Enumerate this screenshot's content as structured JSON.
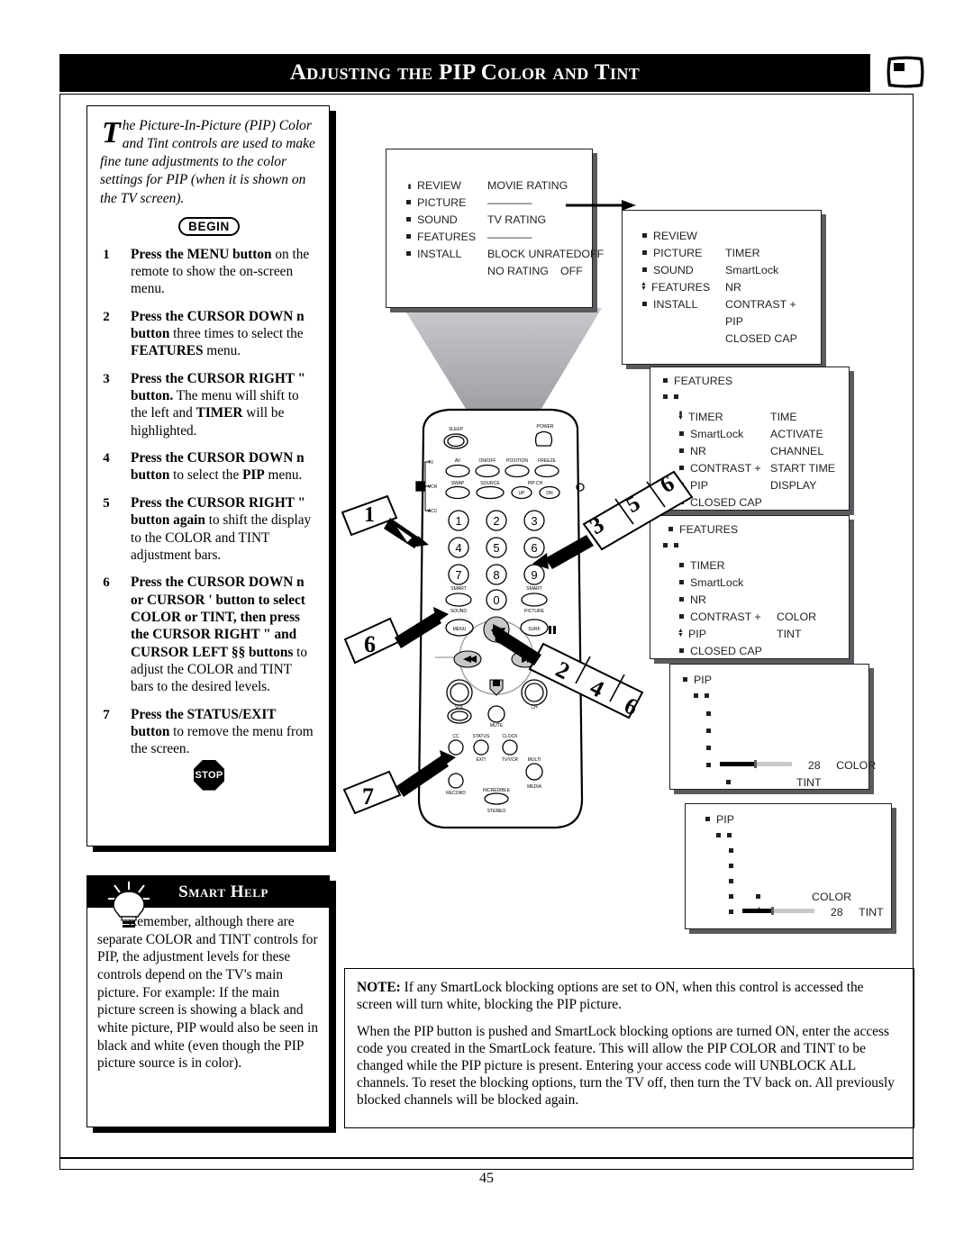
{
  "header": {
    "title": "Adjusting the PIP Color and Tint",
    "icon": "pip-tv-icon"
  },
  "intro": {
    "dropcap": "T",
    "text": "he Picture-In-Picture (PIP) Color and Tint controls are used to make fine tune adjustments to the color settings for PIP (when it is shown on the TV screen)."
  },
  "begin_badge": "BEGIN",
  "stop_badge": "STOP",
  "steps": [
    {
      "num": "1",
      "html": "<b>Press the MENU button</b> on the remote to show the on-screen menu."
    },
    {
      "num": "2",
      "html": "<b>Press the CURSOR DOWN n button</b> three times to select the <b>FEATURES</b> menu."
    },
    {
      "num": "3",
      "html": "<b>Press the CURSOR RIGHT &quot; button.</b> The menu will shift to the left and <b>TIMER</b> will be highlighted."
    },
    {
      "num": "4",
      "html": "<b>Press the CURSOR DOWN n button</b> to select the <b>PIP</b> menu."
    },
    {
      "num": "5",
      "html": "<b>Press the CURSOR RIGHT &quot; button again</b> to shift the display to the COLOR and TINT adjustment bars."
    },
    {
      "num": "6",
      "html": "<b>Press the CURSOR DOWN n or CURSOR ' button to select COLOR or TINT, then press the CURSOR RIGHT &quot; and CURSOR LEFT §§ buttons</b> to adjust the COLOR and TINT bars to the desired levels."
    },
    {
      "num": "7",
      "html": "<b>Press the STATUS/EXIT button</b> to remove the menu from the screen."
    }
  ],
  "smart_help": {
    "title": "Smart Help",
    "icon": "lightbulb-icon",
    "body": "Remember, although there are separate COLOR and TINT controls for PIP, the adjustment levels for these controls depend on the TV's main picture. For example: If the main picture screen is showing a black and white picture, PIP would also be seen in black and white (even though the PIP picture source is in color)."
  },
  "screens": [
    {
      "id": "screen-main-menu",
      "left_items": [
        "REVIEW",
        "PICTURE",
        "SOUND",
        "FEATURES",
        "INSTALL"
      ],
      "right_items": [
        "MOVIE RATING",
        "————",
        "TV RATING",
        "————",
        "BLOCK UNRATED",
        "NO RATING"
      ],
      "right_values": [
        "",
        "",
        "",
        "",
        "OFF",
        "OFF"
      ],
      "cursor_on": "REVIEW"
    },
    {
      "id": "screen-features-highlight",
      "left_items": [
        "REVIEW",
        "PICTURE",
        "SOUND",
        "FEATURES",
        "INSTALL"
      ],
      "right_items": [
        "",
        "TIMER",
        "SmartLock",
        "NR",
        "CONTRAST +",
        "PIP",
        "CLOSED CAP"
      ],
      "cursor_on": "FEATURES"
    },
    {
      "id": "screen-features-timer",
      "title": "FEATURES",
      "left_items": [
        "TIMER",
        "SmartLock",
        "NR",
        "CONTRAST +",
        "PIP",
        "CLOSED CAP"
      ],
      "right_items": [
        "TIME",
        "ACTIVATE",
        "CHANNEL",
        "START TIME",
        "DISPLAY"
      ],
      "cursor_on": "TIMER"
    },
    {
      "id": "screen-features-pip",
      "title": "FEATURES",
      "left_items": [
        "TIMER",
        "SmartLock",
        "NR",
        "CONTRAST +",
        "PIP",
        "CLOSED CAP"
      ],
      "right_items": [
        "COLOR",
        "TINT"
      ],
      "cursor_on": "PIP"
    },
    {
      "id": "screen-pip-color",
      "title": "PIP",
      "selected_label": "COLOR",
      "other_label": "TINT",
      "value": "28"
    },
    {
      "id": "screen-pip-tint",
      "title": "PIP",
      "selected_label": "TINT",
      "other_label": "COLOR",
      "value": "28"
    }
  ],
  "remote": {
    "top_labels": [
      "SLEEP",
      "POWER"
    ],
    "mode_labels": [
      "TV",
      "VCR",
      "ACC"
    ],
    "row1": [
      "AV",
      "ON/OFF",
      "POSITION",
      "FREEZE"
    ],
    "row2": [
      "SWAP",
      "SOURCE",
      "PIP CH",
      "UP",
      "DN"
    ],
    "keypad": [
      "1",
      "2",
      "3",
      "4",
      "5",
      "6",
      "7",
      "8",
      "9",
      "0"
    ],
    "smart_sound": "SMART SOUND",
    "smart_picture": "SMART PICTURE",
    "menu": "MENU",
    "surf": "SURF",
    "vol": "VOL",
    "ch": "CH",
    "mute": "MUTE",
    "cc": "CC",
    "status_exit": "STATUS EXIT",
    "clock_tvvcr": "CLOCK TV/VCR",
    "record": "RECORD",
    "multi_media": "MULTI MEDIA",
    "incredible_stereo": "INCREDIBLE STEREO"
  },
  "callouts": [
    "1",
    "3",
    "5",
    "6",
    "6",
    "2",
    "4",
    "6",
    "7"
  ],
  "note": {
    "label": "NOTE:",
    "paragraph1": " If any SmartLock blocking options are set to ON, when this control is accessed the screen will turn white, blocking the PIP picture.",
    "paragraph2": "When the PIP button is pushed and SmartLock blocking options are turned ON, enter the access code you created in the SmartLock feature. This will allow the PIP COLOR and TINT to be changed while the PIP picture is present. Entering your access code will UNBLOCK ALL channels. To reset the blocking options, turn the TV off, then turn the TV back on. All previously blocked channels will be blocked again."
  },
  "footer": {
    "page_number": "45"
  }
}
